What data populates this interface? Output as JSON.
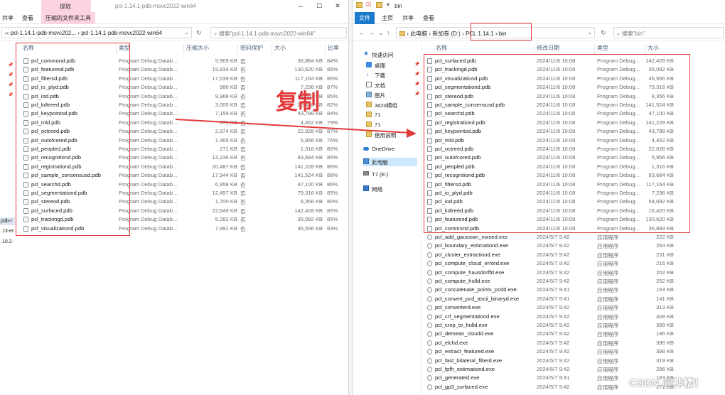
{
  "left": {
    "title": "pcl-1.14.1-pdb-msvc2022-win64",
    "ribbon": {
      "extract_tab": "提取",
      "share_tab": "共享",
      "view_tab": "查看",
      "tools_tab": "压缩的文件夹工具"
    },
    "address": {
      "seg1": "pcl-1.14.1-pdb-msvc202...",
      "seg2": "pcl-1.14.1-pdb-msvc2022-win64",
      "search_placeholder": "搜索\"pcl-1.14.1-pdb-msvc2022-win64\""
    },
    "columns": {
      "name": "名称",
      "type": "类型",
      "compressed": "压缩大小",
      "protect": "密码保护",
      "size": "大小",
      "ratio": "比率"
    },
    "side_texts": [
      "pdb-r",
      ".13-er",
      ".10.2-"
    ],
    "files": [
      {
        "name": "pcl_commond.pdb",
        "type": "Program Debug Datab...",
        "compressed": "5,969 KB",
        "protect": "否",
        "size": "36,884 KB",
        "ratio": "84%"
      },
      {
        "name": "pcl_featuresd.pdb",
        "type": "Program Debug Datab...",
        "compressed": "19,934 KB",
        "protect": "否",
        "size": "130,620 KB",
        "ratio": "85%"
      },
      {
        "name": "pcl_filtersd.pdb",
        "type": "Program Debug Datab...",
        "compressed": "17,539 KB",
        "protect": "否",
        "size": "117,164 KB",
        "ratio": "86%"
      },
      {
        "name": "pcl_io_plyd.pdb",
        "type": "Program Debug Datab...",
        "compressed": "980 KB",
        "protect": "否",
        "size": "7,236 KB",
        "ratio": "87%"
      },
      {
        "name": "pcl_iod.pdb",
        "type": "Program Debug Datab...",
        "compressed": "9,968 KB",
        "protect": "否",
        "size": "64,692 KB",
        "ratio": "85%"
      },
      {
        "name": "pcl_kdtreed.pdb",
        "type": "Program Debug Datab...",
        "compressed": "3,005 KB",
        "protect": "否",
        "size": "16,420 KB",
        "ratio": "82%"
      },
      {
        "name": "pcl_keypointsd.pdb",
        "type": "Program Debug Datab...",
        "compressed": "7,159 KB",
        "protect": "否",
        "size": "43,788 KB",
        "ratio": "84%"
      },
      {
        "name": "pcl_mld.pdb",
        "type": "Program Debug Datab...",
        "compressed": "871 KB",
        "protect": "否",
        "size": "4,452 KB",
        "ratio": "79%"
      },
      {
        "name": "pcl_octreed.pdb",
        "type": "Program Debug Datab...",
        "compressed": "2,974 KB",
        "protect": "否",
        "size": "22,028 KB",
        "ratio": "87%"
      },
      {
        "name": "pcl_outofcored.pdb",
        "type": "Program Debug Datab...",
        "compressed": "1,465 KB",
        "protect": "否",
        "size": "5,956 KB",
        "ratio": "76%"
      },
      {
        "name": "pcl_peopled.pdb",
        "type": "Program Debug Datab...",
        "compressed": "271 KB",
        "protect": "否",
        "size": "1,316 KB",
        "ratio": "80%"
      },
      {
        "name": "pcl_recognitiond.pdb",
        "type": "Program Debug Datab...",
        "compressed": "13,236 KB",
        "protect": "否",
        "size": "83,684 KB",
        "ratio": "85%"
      },
      {
        "name": "pcl_registrationd.pdb",
        "type": "Program Debug Datab...",
        "compressed": "20,487 KB",
        "protect": "否",
        "size": "141,228 KB",
        "ratio": "86%"
      },
      {
        "name": "pcl_sample_consensusd.pdb",
        "type": "Program Debug Datab...",
        "compressed": "17,944 KB",
        "protect": "否",
        "size": "141,524 KB",
        "ratio": "88%"
      },
      {
        "name": "pcl_searchd.pdb",
        "type": "Program Debug Datab...",
        "compressed": "6,958 KB",
        "protect": "否",
        "size": "47,100 KB",
        "ratio": "86%"
      },
      {
        "name": "pcl_segmentationd.pdb",
        "type": "Program Debug Datab...",
        "compressed": "12,497 KB",
        "protect": "否",
        "size": "79,316 KB",
        "ratio": "85%"
      },
      {
        "name": "pcl_stereod.pdb",
        "type": "Program Debug Datab...",
        "compressed": "1,700 KB",
        "protect": "否",
        "size": "8,356 KB",
        "ratio": "80%"
      },
      {
        "name": "pcl_surfaced.pdb",
        "type": "Program Debug Datab...",
        "compressed": "22,649 KB",
        "protect": "否",
        "size": "142,428 KB",
        "ratio": "85%"
      },
      {
        "name": "pcl_trackingd.pdb",
        "type": "Program Debug Datab...",
        "compressed": "5,282 KB",
        "protect": "否",
        "size": "35,092 KB",
        "ratio": "85%"
      },
      {
        "name": "pcl_visualizationd.pdb",
        "type": "Program Debug Datab...",
        "compressed": "7,991 KB",
        "protect": "否",
        "size": "46,556 KB",
        "ratio": "83%"
      }
    ]
  },
  "right": {
    "title": "bin",
    "ribbon": {
      "file_tab": "文件",
      "home_tab": "主页",
      "share_tab": "共享",
      "view_tab": "查看"
    },
    "address": {
      "thispc": "此电脑",
      "drive": "新加卷 (D:)",
      "folder": "PCL 1.14.1",
      "sub": "bin",
      "search_placeholder": "搜索\"bin\""
    },
    "columns": {
      "name": "名称",
      "date": "修改日期",
      "type": "类型",
      "size": "大小"
    },
    "nav": [
      {
        "label": "快速访问",
        "icon": "star-icon"
      },
      {
        "label": "桌面",
        "icon": "desktop-icon"
      },
      {
        "label": "下载",
        "icon": "download-icon"
      },
      {
        "label": "文档",
        "icon": "document-icon"
      },
      {
        "label": "图片",
        "icon": "picture-icon"
      },
      {
        "label": "3d2d横组",
        "icon": "folder-icon"
      },
      {
        "label": "71",
        "icon": "folder-icon"
      },
      {
        "label": "71",
        "icon": "folder-icon"
      },
      {
        "label": "使用说明",
        "icon": "folder-icon"
      },
      {
        "label": "OneDrive",
        "icon": "cloud-icon"
      },
      {
        "label": "此电脑",
        "icon": "computer-icon"
      },
      {
        "label": "T7 (E:)",
        "icon": "drive-icon"
      },
      {
        "label": "网络",
        "icon": "network-icon"
      }
    ],
    "files": [
      {
        "name": "pcl_surfaced.pdb",
        "date": "2024/11/6 10:08",
        "type": "Program Debug...",
        "size": "142,428 KB",
        "kind": "pdb"
      },
      {
        "name": "pcl_trackingd.pdb",
        "date": "2024/11/6 10:08",
        "type": "Program Debug...",
        "size": "35,092 KB",
        "kind": "pdb"
      },
      {
        "name": "pcl_visualizationd.pdb",
        "date": "2024/11/6 10:08",
        "type": "Program Debug...",
        "size": "46,556 KB",
        "kind": "pdb"
      },
      {
        "name": "pcl_segmentationd.pdb",
        "date": "2024/11/6 10:08",
        "type": "Program Debug...",
        "size": "79,316 KB",
        "kind": "pdb"
      },
      {
        "name": "pcl_stereod.pdb",
        "date": "2024/11/6 10:08",
        "type": "Program Debug...",
        "size": "8,356 KB",
        "kind": "pdb"
      },
      {
        "name": "pcl_sample_consensusd.pdb",
        "date": "2024/11/6 10:08",
        "type": "Program Debug...",
        "size": "141,524 KB",
        "kind": "pdb"
      },
      {
        "name": "pcl_searchd.pdb",
        "date": "2024/11/6 10:08",
        "type": "Program Debug...",
        "size": "47,100 KB",
        "kind": "pdb"
      },
      {
        "name": "pcl_registrationd.pdb",
        "date": "2024/11/6 10:08",
        "type": "Program Debug...",
        "size": "141,228 KB",
        "kind": "pdb"
      },
      {
        "name": "pcl_keypointsd.pdb",
        "date": "2024/11/6 10:08",
        "type": "Program Debug...",
        "size": "43,788 KB",
        "kind": "pdb"
      },
      {
        "name": "pcl_mld.pdb",
        "date": "2024/11/6 10:08",
        "type": "Program Debug...",
        "size": "4,452 KB",
        "kind": "pdb"
      },
      {
        "name": "pcl_octreed.pdb",
        "date": "2024/11/6 10:08",
        "type": "Program Debug...",
        "size": "22,028 KB",
        "kind": "pdb"
      },
      {
        "name": "pcl_outofcored.pdb",
        "date": "2024/11/6 10:08",
        "type": "Program Debug...",
        "size": "5,956 KB",
        "kind": "pdb"
      },
      {
        "name": "pcl_peopled.pdb",
        "date": "2024/11/6 10:08",
        "type": "Program Debug...",
        "size": "1,316 KB",
        "kind": "pdb"
      },
      {
        "name": "pcl_recognitiond.pdb",
        "date": "2024/11/6 10:08",
        "type": "Program Debug...",
        "size": "83,684 KB",
        "kind": "pdb"
      },
      {
        "name": "pcl_filtersd.pdb",
        "date": "2024/11/6 10:08",
        "type": "Program Debug...",
        "size": "117,164 KB",
        "kind": "pdb"
      },
      {
        "name": "pcl_io_plyd.pdb",
        "date": "2024/11/6 10:08",
        "type": "Program Debug...",
        "size": "7,236 KB",
        "kind": "pdb"
      },
      {
        "name": "pcl_iod.pdb",
        "date": "2024/11/6 10:08",
        "type": "Program Debug...",
        "size": "64,692 KB",
        "kind": "pdb"
      },
      {
        "name": "pcl_kdtreed.pdb",
        "date": "2024/11/6 10:08",
        "type": "Program Debug...",
        "size": "16,420 KB",
        "kind": "pdb"
      },
      {
        "name": "pcl_featuresd.pdb",
        "date": "2024/11/6 10:08",
        "type": "Program Debug...",
        "size": "130,620 KB",
        "kind": "pdb"
      },
      {
        "name": "pcl_commond.pdb",
        "date": "2024/11/6 10:08",
        "type": "Program Debug...",
        "size": "36,884 KB",
        "kind": "pdb"
      },
      {
        "name": "pcl_add_gaussian_noised.exe",
        "date": "2024/5/7 9:42",
        "type": "应用程序",
        "size": "222 KB",
        "kind": "exe"
      },
      {
        "name": "pcl_boundary_estimationd.exe",
        "date": "2024/5/7 9:42",
        "type": "应用程序",
        "size": "264 KB",
        "kind": "exe"
      },
      {
        "name": "pcl_cluster_extractiond.exe",
        "date": "2024/5/7 9:42",
        "type": "应用程序",
        "size": "231 KB",
        "kind": "exe"
      },
      {
        "name": "pcl_compute_cloud_errord.exe",
        "date": "2024/5/7 9:42",
        "type": "应用程序",
        "size": "216 KB",
        "kind": "exe"
      },
      {
        "name": "pcl_compute_hausdorffd.exe",
        "date": "2024/5/7 9:42",
        "type": "应用程序",
        "size": "202 KB",
        "kind": "exe"
      },
      {
        "name": "pcl_compute_hulld.exe",
        "date": "2024/5/7 9:42",
        "type": "应用程序",
        "size": "252 KB",
        "kind": "exe"
      },
      {
        "name": "pcl_concatenate_points_pcdd.exe",
        "date": "2024/5/7 9:41",
        "type": "应用程序",
        "size": "153 KB",
        "kind": "exe"
      },
      {
        "name": "pcl_convert_pcd_ascii_binaryd.exe",
        "date": "2024/5/7 9:41",
        "type": "应用程序",
        "size": "141 KB",
        "kind": "exe"
      },
      {
        "name": "pcl_converterd.exe",
        "date": "2024/5/7 9:42",
        "type": "应用程序",
        "size": "313 KB",
        "kind": "exe"
      },
      {
        "name": "pcl_crf_segmentationd.exe",
        "date": "2024/5/7 9:42",
        "type": "应用程序",
        "size": "408 KB",
        "kind": "exe"
      },
      {
        "name": "pcl_crop_to_hulld.exe",
        "date": "2024/5/7 9:42",
        "type": "应用程序",
        "size": "399 KB",
        "kind": "exe"
      },
      {
        "name": "pcl_demean_cloudd.exe",
        "date": "2024/5/7 9:42",
        "type": "应用程序",
        "size": "186 KB",
        "kind": "exe"
      },
      {
        "name": "pcl_elchd.exe",
        "date": "2024/5/7 9:42",
        "type": "应用程序",
        "size": "396 KB",
        "kind": "exe"
      },
      {
        "name": "pcl_extract_featured.exe",
        "date": "2024/5/7 9:42",
        "type": "应用程序",
        "size": "398 KB",
        "kind": "exe"
      },
      {
        "name": "pcl_fast_bilateral_filterd.exe",
        "date": "2024/5/7 9:42",
        "type": "应用程序",
        "size": "319 KB",
        "kind": "exe"
      },
      {
        "name": "pcl_fpfh_estimationd.exe",
        "date": "2024/5/7 9:42",
        "type": "应用程序",
        "size": "296 KB",
        "kind": "exe"
      },
      {
        "name": "pcl_generated.exe",
        "date": "2024/5/7 9:41",
        "type": "应用程序",
        "size": "163 KB",
        "kind": "exe"
      },
      {
        "name": "pcl_gp3_surfaced.exe",
        "date": "2024/5/7 9:42",
        "type": "应用程序",
        "size": "271 KB",
        "kind": "exe"
      }
    ]
  },
  "annotation": {
    "copy_label": "复制",
    "watermark": "CSDN @神楼！"
  }
}
